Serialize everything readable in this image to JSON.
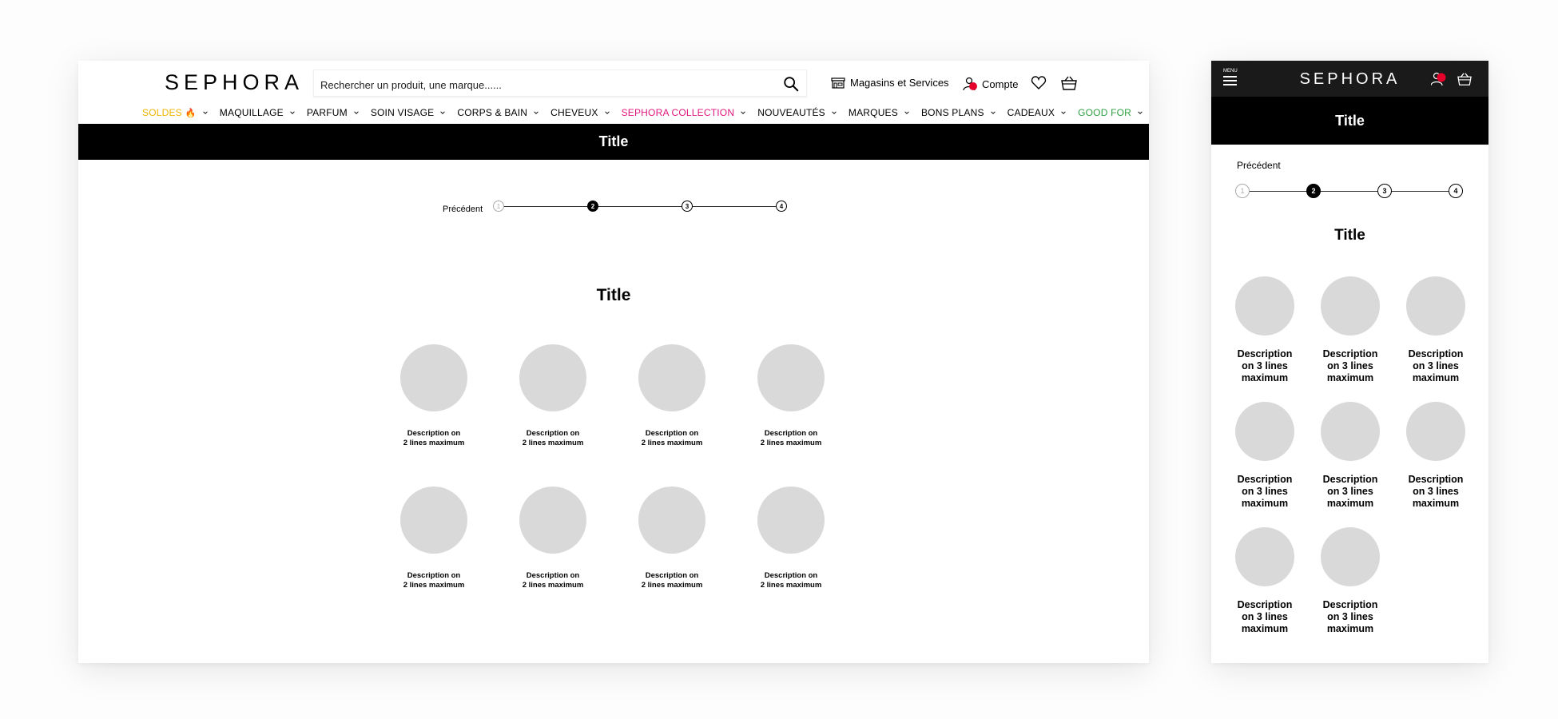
{
  "desktop": {
    "logo": "SEPHORA",
    "search": {
      "placeholder": "Rechercher un produit, une marque......"
    },
    "header": {
      "stores_label": "Magasins et Services",
      "account_label": "Compte"
    },
    "nav": [
      {
        "label": "SOLDES",
        "emoji": "🔥",
        "color": "#f0b400"
      },
      {
        "label": "MAQUILLAGE",
        "emoji": "",
        "color": "#000000"
      },
      {
        "label": "PARFUM",
        "emoji": "",
        "color": "#000000"
      },
      {
        "label": "SOIN VISAGE",
        "emoji": "",
        "color": "#000000"
      },
      {
        "label": "CORPS & BAIN",
        "emoji": "",
        "color": "#000000"
      },
      {
        "label": "CHEVEUX",
        "emoji": "",
        "color": "#000000"
      },
      {
        "label": "SEPHORA COLLECTION",
        "emoji": "",
        "color": "#e0167d"
      },
      {
        "label": "NOUVEAUTÉS",
        "emoji": "",
        "color": "#000000"
      },
      {
        "label": "MARQUES",
        "emoji": "",
        "color": "#000000"
      },
      {
        "label": "BONS PLANS",
        "emoji": "",
        "color": "#000000"
      },
      {
        "label": "CADEAUX",
        "emoji": "",
        "color": "#000000"
      },
      {
        "label": "GOOD FOR",
        "emoji": "",
        "color": "#2ea043"
      }
    ],
    "title_bar": "Title",
    "previous": "Précédent",
    "steps": [
      "1",
      "2",
      "3",
      "4"
    ],
    "active_step": 2,
    "section_title": "Title",
    "tiles": [
      "Description on\n2 lines maximum",
      "Description on\n2 lines maximum",
      "Description on\n2 lines maximum",
      "Description on\n2 lines maximum",
      "Description on\n2 lines maximum",
      "Description on\n2 lines maximum",
      "Description on\n2 lines maximum",
      "Description on\n2 lines maximum"
    ]
  },
  "mobile": {
    "menu_label": "MENU",
    "logo": "SEPHORA",
    "title_bar": "Title",
    "previous": "Précédent",
    "steps": [
      "1",
      "2",
      "3",
      "4"
    ],
    "active_step": 2,
    "section_title": "Title",
    "tiles": [
      "Description\non 3 lines\nmaximum",
      "Description\non 3 lines\nmaximum",
      "Description\non 3 lines\nmaximum",
      "Description\non 3 lines\nmaximum",
      "Description\non 3 lines\nmaximum",
      "Description\non 3 lines\nmaximum",
      "Description\non 3 lines\nmaximum",
      "Description\non 3 lines\nmaximum"
    ]
  },
  "colors": {
    "accent_red": "#e4002b",
    "placeholder_grey": "#d9d9d9"
  }
}
